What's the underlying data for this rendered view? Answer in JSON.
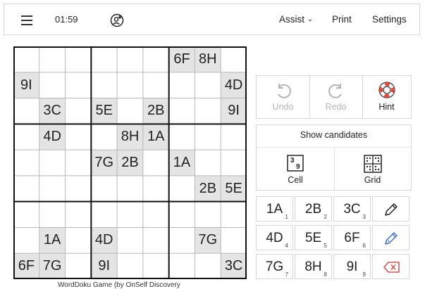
{
  "header": {
    "timer": "01:59",
    "menu": [
      "Assist",
      "Print",
      "Settings"
    ],
    "assist_caret": "⌄"
  },
  "icons": {
    "menu": "hamburger-icon",
    "add_player": "add-user-icon",
    "undo": "undo-icon",
    "redo": "redo-icon",
    "hint": "lifebuoy-icon",
    "cell": "cell-candidates-icon",
    "grid": "grid-candidates-icon",
    "pencil": "pencil-icon",
    "pencil_fill": "pencil-fill-icon",
    "erase": "erase-icon"
  },
  "grid": {
    "rows": [
      [
        "",
        "",
        "",
        "",
        "",
        "",
        "6F",
        "8H",
        ""
      ],
      [
        "9I",
        "",
        "",
        "",
        "",
        "",
        "",
        "",
        "4D"
      ],
      [
        "",
        "3C",
        "",
        "5E",
        "",
        "2B",
        "",
        "",
        "9I"
      ],
      [
        "",
        "4D",
        "",
        "",
        "8H",
        "1A",
        "",
        "",
        ""
      ],
      [
        "",
        "",
        "",
        "7G",
        "2B",
        "",
        "1A",
        "",
        ""
      ],
      [
        "",
        "",
        "",
        "",
        "",
        "",
        "",
        "2B",
        "5E"
      ],
      [
        "",
        "",
        "",
        "",
        "",
        "",
        "",
        "",
        ""
      ],
      [
        "",
        "1A",
        "",
        "4D",
        "",
        "",
        "",
        "7G",
        ""
      ],
      [
        "6F",
        "7G",
        "",
        "9I",
        "",
        "",
        "",
        "",
        "3C"
      ]
    ]
  },
  "actions": {
    "undo": "Undo",
    "redo": "Redo",
    "hint": "Hint"
  },
  "candidates": {
    "title": "Show candidates",
    "cell": "Cell",
    "grid": "Grid",
    "cell_icon_digits": [
      "3",
      "9"
    ]
  },
  "keypad": [
    {
      "label": "1A",
      "sub": "1"
    },
    {
      "label": "2B",
      "sub": "2"
    },
    {
      "label": "3C",
      "sub": "3"
    },
    {
      "label": "4D",
      "sub": "4"
    },
    {
      "label": "5E",
      "sub": "5"
    },
    {
      "label": "6F",
      "sub": "6"
    },
    {
      "label": "7G",
      "sub": "7"
    },
    {
      "label": "8H",
      "sub": "8"
    },
    {
      "label": "9I",
      "sub": "9"
    }
  ],
  "footer": "WordDoku Game (by OnSelf Discovery"
}
